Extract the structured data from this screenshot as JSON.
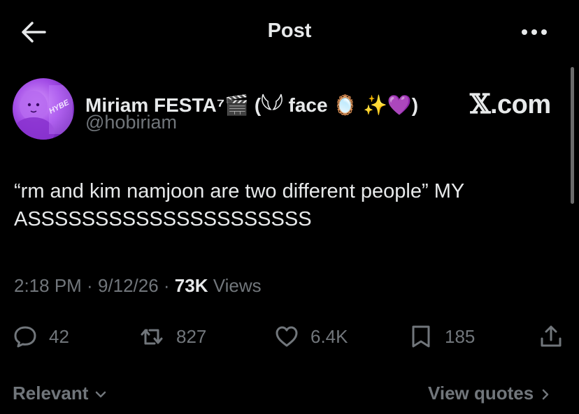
{
  "header": {
    "title": "Post",
    "back_icon": "arrow-left-icon",
    "more_icon": "more-horizontal-icon"
  },
  "author": {
    "display_name": "Miriam FESTA⁷🎬 (𓆩𓆪 face 🪞 ✨💜)",
    "handle": "@hobiriam",
    "avatar_text": "HYBE"
  },
  "brand": {
    "logo": "𝕏",
    "suffix": ".com"
  },
  "tweet": {
    "text": "“rm and kim namjoon are two different people” MY ASSSSSSSSSSSSSSSSSSSSS"
  },
  "meta": {
    "time": "2:18 PM",
    "separator": " · ",
    "date": "9/12/26",
    "views_count": "73K",
    "views_label": " Views"
  },
  "actions": {
    "replies": "42",
    "reposts": "827",
    "likes": "6.4K",
    "bookmarks": "185"
  },
  "footer": {
    "sort_label": "Relevant",
    "quotes_label": "View quotes"
  },
  "colors": {
    "background": "#000000",
    "text": "#e7e9ea",
    "muted": "#71767b",
    "avatar_purple": "#a24ce6"
  }
}
